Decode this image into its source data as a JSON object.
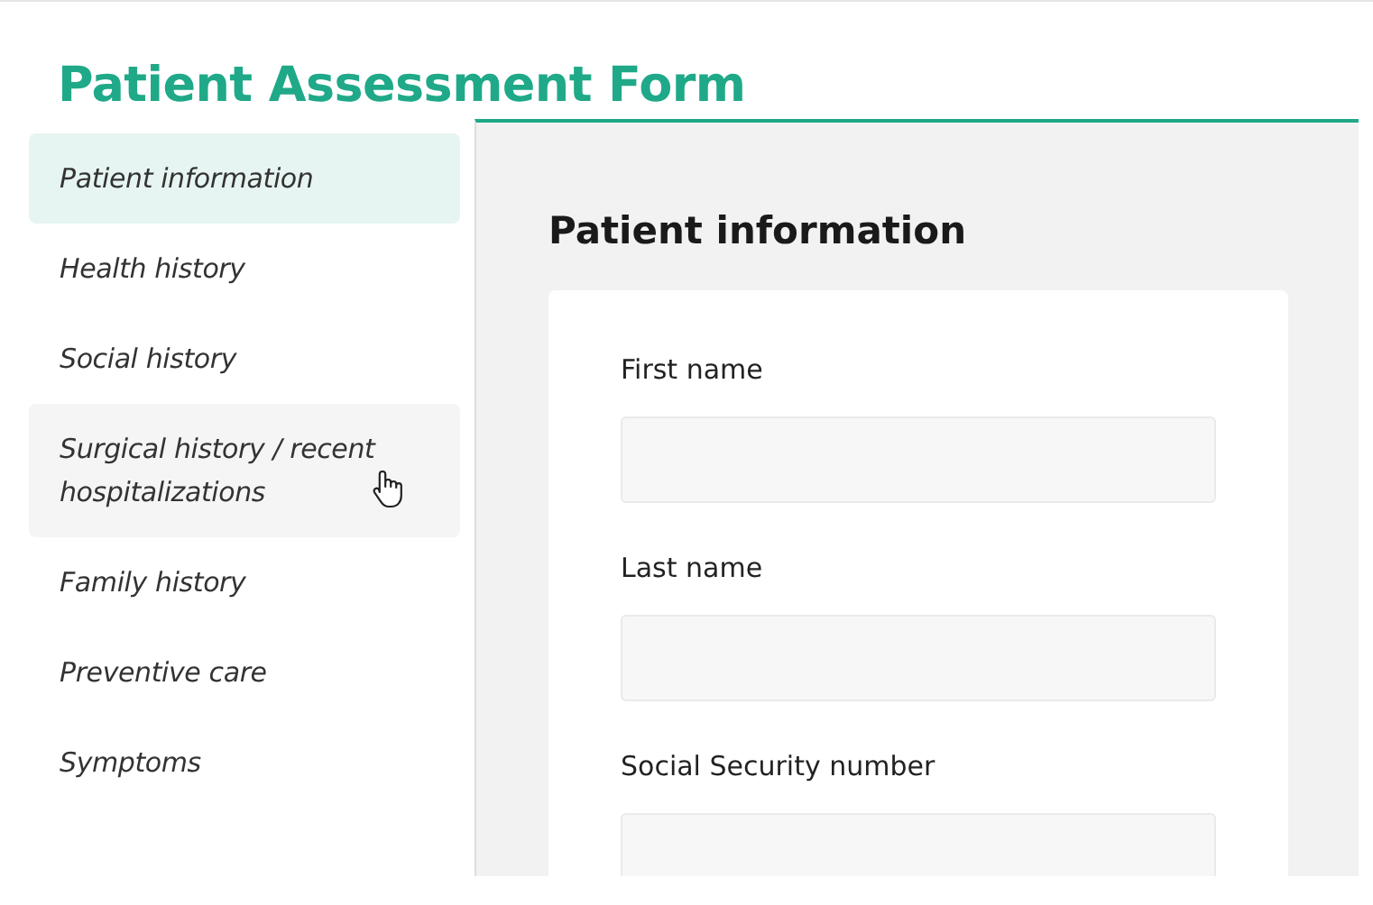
{
  "title": "Patient Assessment Form",
  "sidebar": {
    "items": [
      {
        "label": "Patient information",
        "selected": true,
        "hovered": false
      },
      {
        "label": "Health history",
        "selected": false,
        "hovered": false
      },
      {
        "label": "Social history",
        "selected": false,
        "hovered": false
      },
      {
        "label": "Surgical history / recent hospitalizations",
        "selected": false,
        "hovered": true
      },
      {
        "label": "Family history",
        "selected": false,
        "hovered": false
      },
      {
        "label": "Preventive care",
        "selected": false,
        "hovered": false
      },
      {
        "label": "Symptoms",
        "selected": false,
        "hovered": false
      }
    ]
  },
  "section": {
    "heading": "Patient information",
    "fields": [
      {
        "label": "First name"
      },
      {
        "label": "Last name"
      },
      {
        "label": "Social Security number"
      }
    ]
  }
}
